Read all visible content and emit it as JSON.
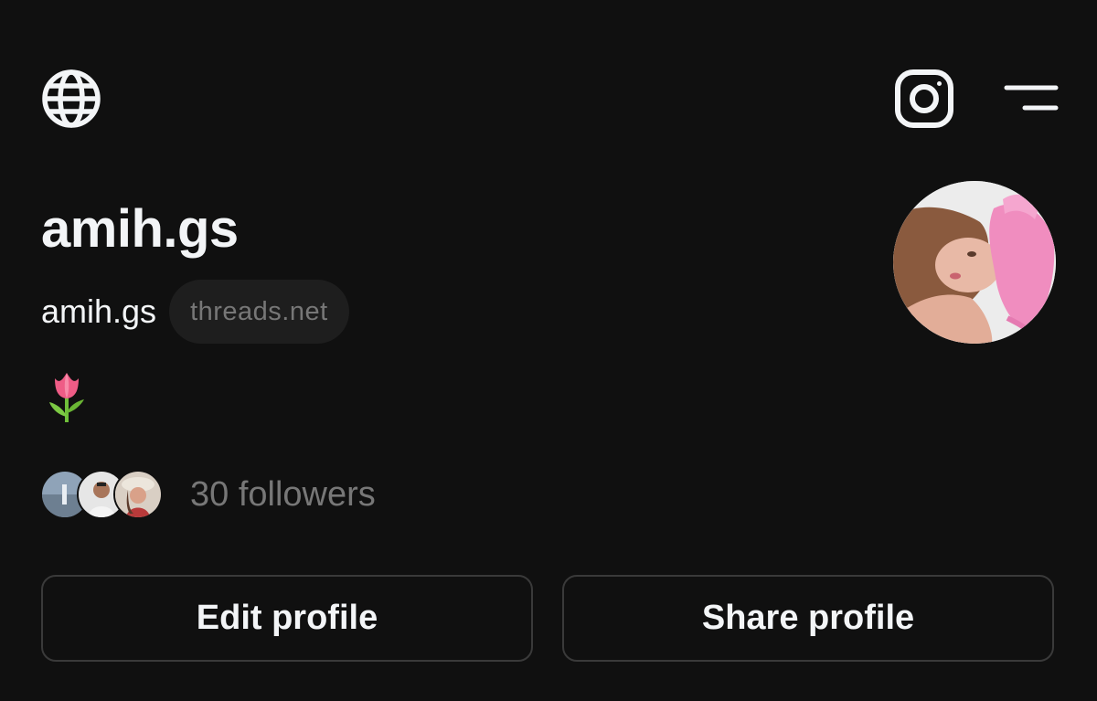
{
  "header": {
    "left_icon": "globe-icon",
    "right_icons": [
      "instagram-icon",
      "menu-icon"
    ]
  },
  "profile": {
    "display_name": "amih.gs",
    "username": "amih.gs",
    "domain_badge": "threads.net",
    "bio_icon": "tulip-emoji",
    "followers_label": "30 followers"
  },
  "actions": {
    "edit_label": "Edit profile",
    "share_label": "Share profile"
  },
  "colors": {
    "background": "#101010",
    "text_primary": "#f3f5f7",
    "text_secondary": "#777777",
    "chip_bg": "#1e1e1e",
    "button_border": "#3a3a3a"
  }
}
